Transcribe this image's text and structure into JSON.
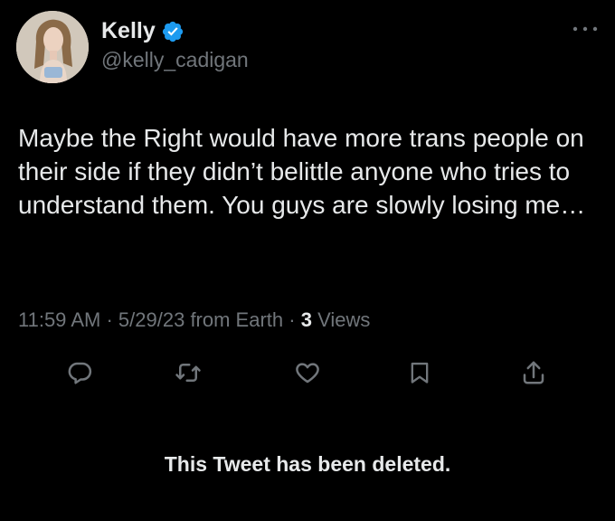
{
  "author": {
    "name": "Kelly",
    "handle": "@kelly_cadigan",
    "verified": true,
    "avatar_icon": "profile-photo"
  },
  "tweet": {
    "text": "Maybe the Right would have more trans people on their side if they didn’t belittle anyone who tries to understand them. You guys are slowly losing me…",
    "time": "11:59 AM",
    "date": "5/29/23",
    "source": "from Earth",
    "views_count": "3",
    "views_label": "Views",
    "separator": "·"
  },
  "actions": [
    {
      "icon": "reply-icon"
    },
    {
      "icon": "retweet-icon"
    },
    {
      "icon": "like-icon"
    },
    {
      "icon": "bookmark-icon"
    },
    {
      "icon": "share-icon"
    }
  ],
  "notice": "This Tweet has been deleted.",
  "colors": {
    "background": "#000000",
    "text": "#e7e9ea",
    "secondary": "#71767b",
    "verified": "#1d9bf0"
  }
}
